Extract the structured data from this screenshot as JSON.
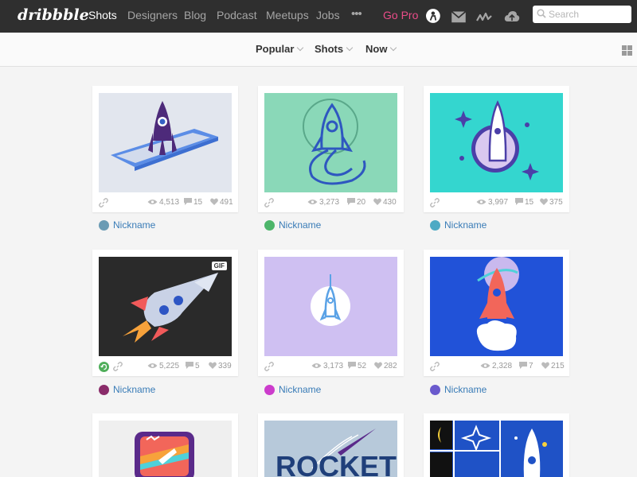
{
  "header": {
    "logo": "dribbble",
    "nav": [
      {
        "label": "Shots",
        "active": true
      },
      {
        "label": "Designers"
      },
      {
        "label": "Blog"
      },
      {
        "label": "Podcast"
      },
      {
        "label": "Meetups"
      },
      {
        "label": "Jobs"
      },
      {
        "label": "•••"
      },
      {
        "label": "Go Pro",
        "accent": "#ea4c89"
      }
    ],
    "icons": [
      "profile-icon",
      "mail-icon",
      "activity-icon",
      "upload-icon"
    ],
    "search_placeholder": "Search"
  },
  "filters": [
    {
      "label": "Popular"
    },
    {
      "label": "Shots"
    },
    {
      "label": "Now"
    }
  ],
  "shots": [
    {
      "views": "4,513",
      "comments": "15",
      "likes": "491",
      "user": "Nickname",
      "avatar_color": "#6a9bb4",
      "bg": "#e2e6ee"
    },
    {
      "views": "3,273",
      "comments": "20",
      "likes": "430",
      "user": "Nickname",
      "avatar_color": "#4db56a",
      "bg": "#8ad8b8"
    },
    {
      "views": "3,997",
      "comments": "15",
      "likes": "375",
      "user": "Nickname",
      "avatar_color": "#4eaac4",
      "bg": "#34d6cf"
    },
    {
      "views": "5,225",
      "comments": "5",
      "likes": "339",
      "user": "Nickname",
      "avatar_color": "#8a2c6a",
      "bg": "#2a2a2a",
      "badge": "GIF"
    },
    {
      "views": "3,173",
      "comments": "52",
      "likes": "282",
      "user": "Nickname",
      "avatar_color": "#cc3ccc",
      "bg": "#cfc0f2"
    },
    {
      "views": "2,328",
      "comments": "7",
      "likes": "215",
      "user": "Nickname",
      "avatar_color": "#6a5acd",
      "bg": "#2152d8"
    },
    {
      "bg": "#efefef"
    },
    {
      "bg": "#b7c9da",
      "title_text": "ROCKET"
    },
    {
      "bg": "#1f52c6"
    }
  ]
}
